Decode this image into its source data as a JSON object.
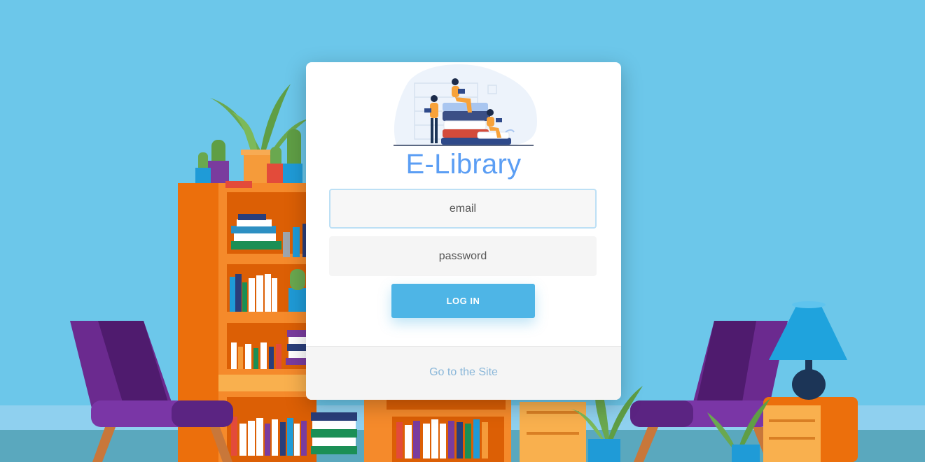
{
  "brand": {
    "title": "E-Library"
  },
  "login_form": {
    "email_placeholder": "email",
    "password_placeholder": "password",
    "submit_label": "LOG IN"
  },
  "footer": {
    "link_label": "Go to the Site"
  },
  "colors": {
    "background": "#6cc7ea",
    "accent": "#4eb5e6",
    "brand_text": "#5b9ef4",
    "link": "#8ab7d9",
    "bookcase": "#f07e1e",
    "chair": "#6b2a8f"
  },
  "icons": [
    "library-illustration"
  ]
}
